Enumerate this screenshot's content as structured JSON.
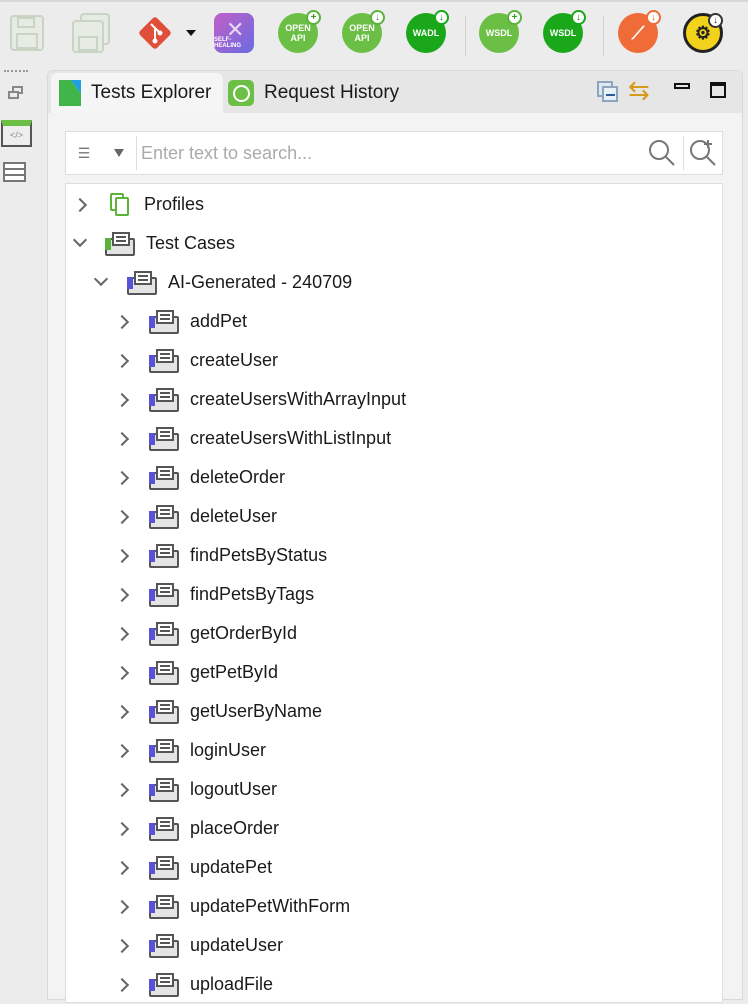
{
  "toolbar": {
    "buttons": [
      {
        "name": "save",
        "icon": "save-icon",
        "enabled": false
      },
      {
        "name": "save-all",
        "icon": "save-all-icon",
        "enabled": false
      },
      {
        "name": "git",
        "icon": "git-icon"
      },
      {
        "name": "self-healing",
        "icon": "self-healing-icon",
        "label": "SELF-HEALING"
      },
      {
        "name": "openapi-add",
        "label_top": "OPEN",
        "label_bottom": "API",
        "badge": "+"
      },
      {
        "name": "openapi-import",
        "label_top": "OPEN",
        "label_bottom": "API",
        "badge": "↓"
      },
      {
        "name": "wadl-import",
        "label": "WADL",
        "badge": "↓"
      },
      {
        "name": "wsdl-add",
        "label": "WSDL",
        "badge": "+"
      },
      {
        "name": "wsdl-import",
        "label": "WSDL",
        "badge": "↓"
      },
      {
        "name": "postman-import",
        "icon": "postman-icon",
        "badge": "↓"
      },
      {
        "name": "plugin-import",
        "icon": "gear-icon",
        "badge": "↓"
      }
    ]
  },
  "tabs": [
    {
      "label": "Tests Explorer",
      "active": true
    },
    {
      "label": "Request History",
      "active": false
    }
  ],
  "search": {
    "placeholder": "Enter text to search...",
    "value": ""
  },
  "tree": {
    "profiles": "Profiles",
    "test_cases": "Test Cases",
    "folder": "AI-Generated - 240709",
    "items": [
      "addPet",
      "createUser",
      "createUsersWithArrayInput",
      "createUsersWithListInput",
      "deleteOrder",
      "deleteUser",
      "findPetsByStatus",
      "findPetsByTags",
      "getOrderById",
      "getPetById",
      "getUserByName",
      "loginUser",
      "logoutUser",
      "placeOrder",
      "updatePet",
      "updatePetWithForm",
      "updateUser",
      "uploadFile"
    ]
  },
  "colors": {
    "green": "#5bb33a",
    "dark_green": "#1aa81a",
    "orange": "#ef6b37",
    "git": "#e04e39",
    "purple": "#5a52d6"
  }
}
